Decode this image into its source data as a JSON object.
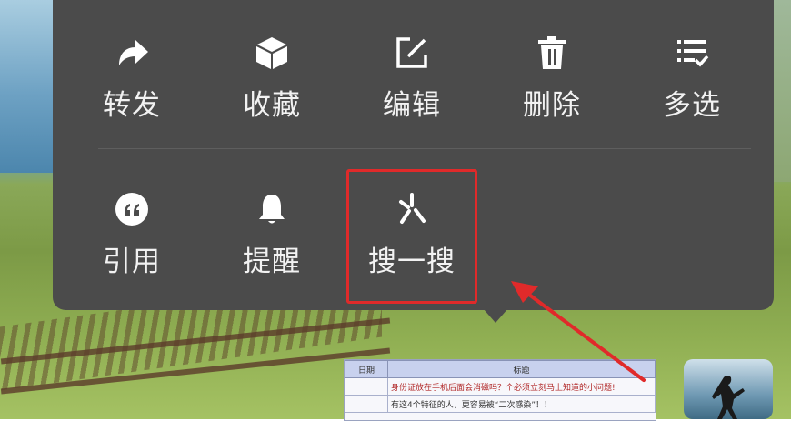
{
  "menu": {
    "row1": [
      {
        "label": "转发",
        "icon": "forward-arrow-icon"
      },
      {
        "label": "收藏",
        "icon": "cube-icon"
      },
      {
        "label": "编辑",
        "icon": "edit-icon"
      },
      {
        "label": "删除",
        "icon": "trash-icon"
      },
      {
        "label": "多选",
        "icon": "multi-select-icon"
      }
    ],
    "row2": [
      {
        "label": "引用",
        "icon": "quote-icon"
      },
      {
        "label": "提醒",
        "icon": "bell-icon"
      },
      {
        "label": "搜一搜",
        "icon": "search-spark-icon"
      }
    ]
  },
  "thumbnail_table": {
    "headers": [
      "日期",
      "标题"
    ],
    "rows": [
      [
        "",
        "身份证放在手机后面会消磁吗？个必须立刻马上知道的小问题!"
      ],
      [
        "",
        "有这4个特征的人，更容易被“二次感染”！！"
      ]
    ]
  },
  "colors": {
    "menu_bg": "#4b4b4b",
    "highlight": "#e02a2a",
    "arrow": "#e02a2a"
  }
}
